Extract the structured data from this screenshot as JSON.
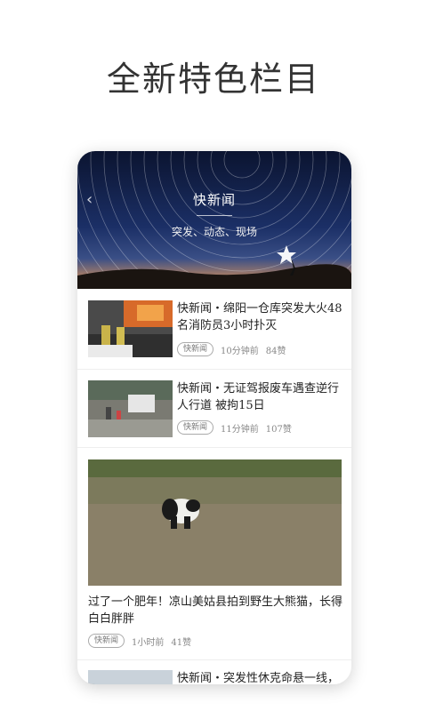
{
  "headline": "全新特色栏目",
  "banner": {
    "title": "快新闻",
    "subtitle": "突发、动态、现场"
  },
  "items": [
    {
      "title": "快新闻・绵阳一仓库突发大火48名消防员3小时扑灭",
      "tag": "快新闻",
      "time": "10分钟前",
      "likes": "84赞"
    },
    {
      "title": "快新闻・无证驾报废车遇查逆行人行道 被拘15日",
      "tag": "快新闻",
      "time": "11分钟前",
      "likes": "107赞"
    }
  ],
  "feature": {
    "title": "过了一个肥年！凉山美姑县拍到野生大熊猫，长得白白胖胖",
    "tag": "快新闻",
    "time": "1小时前",
    "likes": "41赞"
  },
  "partial": {
    "title": "快新闻・突发性休克命悬一线，"
  }
}
